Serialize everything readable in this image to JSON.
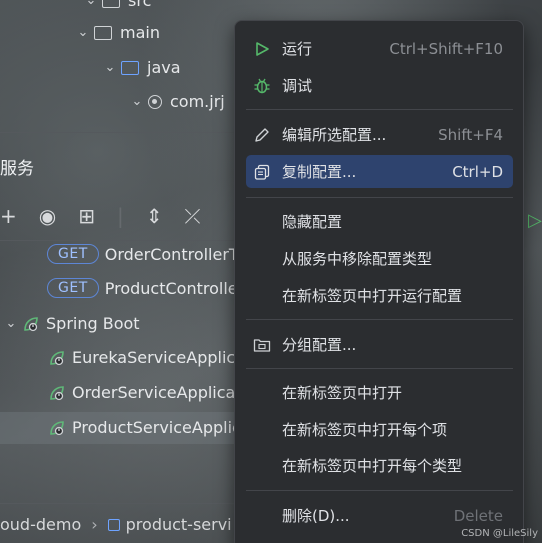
{
  "project_tree": {
    "rows": [
      {
        "label": "src"
      },
      {
        "label": "main"
      },
      {
        "label": "java"
      },
      {
        "label": "com.jrj"
      }
    ]
  },
  "services": {
    "title": "服务",
    "get_badge": "GET",
    "endpoints": [
      {
        "label": "OrderControllerT"
      },
      {
        "label": "ProductControlle"
      }
    ],
    "group": "Spring Boot",
    "apps": [
      {
        "label": "EurekaServiceApplica"
      },
      {
        "label": "OrderServiceApplicat"
      },
      {
        "label": "ProductServiceApplic"
      }
    ]
  },
  "breadcrumbs": {
    "items": [
      "oud-demo",
      "product-servi"
    ]
  },
  "context_menu": {
    "items": [
      {
        "label": "运行",
        "shortcut": "Ctrl+Shift+F10",
        "icon": "run-icon"
      },
      {
        "label": "调试",
        "shortcut": "",
        "icon": "debug-icon"
      },
      {
        "label": "编辑所选配置...",
        "shortcut": "Shift+F4",
        "icon": "edit-icon"
      },
      {
        "label": "复制配置...",
        "shortcut": "Ctrl+D",
        "icon": "copy-icon"
      },
      {
        "label": "隐藏配置",
        "shortcut": "",
        "icon": ""
      },
      {
        "label": "从服务中移除配置类型",
        "shortcut": "",
        "icon": ""
      },
      {
        "label": "在新标签页中打开运行配置",
        "shortcut": "",
        "icon": ""
      },
      {
        "label": "分组配置...",
        "shortcut": "",
        "icon": "folder-group-icon"
      },
      {
        "label": "在新标签页中打开",
        "shortcut": "",
        "icon": ""
      },
      {
        "label": "在新标签页中打开每个项",
        "shortcut": "",
        "icon": ""
      },
      {
        "label": "在新标签页中打开每个类型",
        "shortcut": "",
        "icon": ""
      },
      {
        "label": "删除(D)...",
        "shortcut": "Delete",
        "icon": ""
      }
    ],
    "highlighted_index": 3
  },
  "watermark": "CSDN @LileSily",
  "colors": {
    "menu_bg": "#2b2d30",
    "highlight": "#2e436e",
    "run_green": "#55b86a",
    "folder_blue": "#6ea3ff"
  }
}
